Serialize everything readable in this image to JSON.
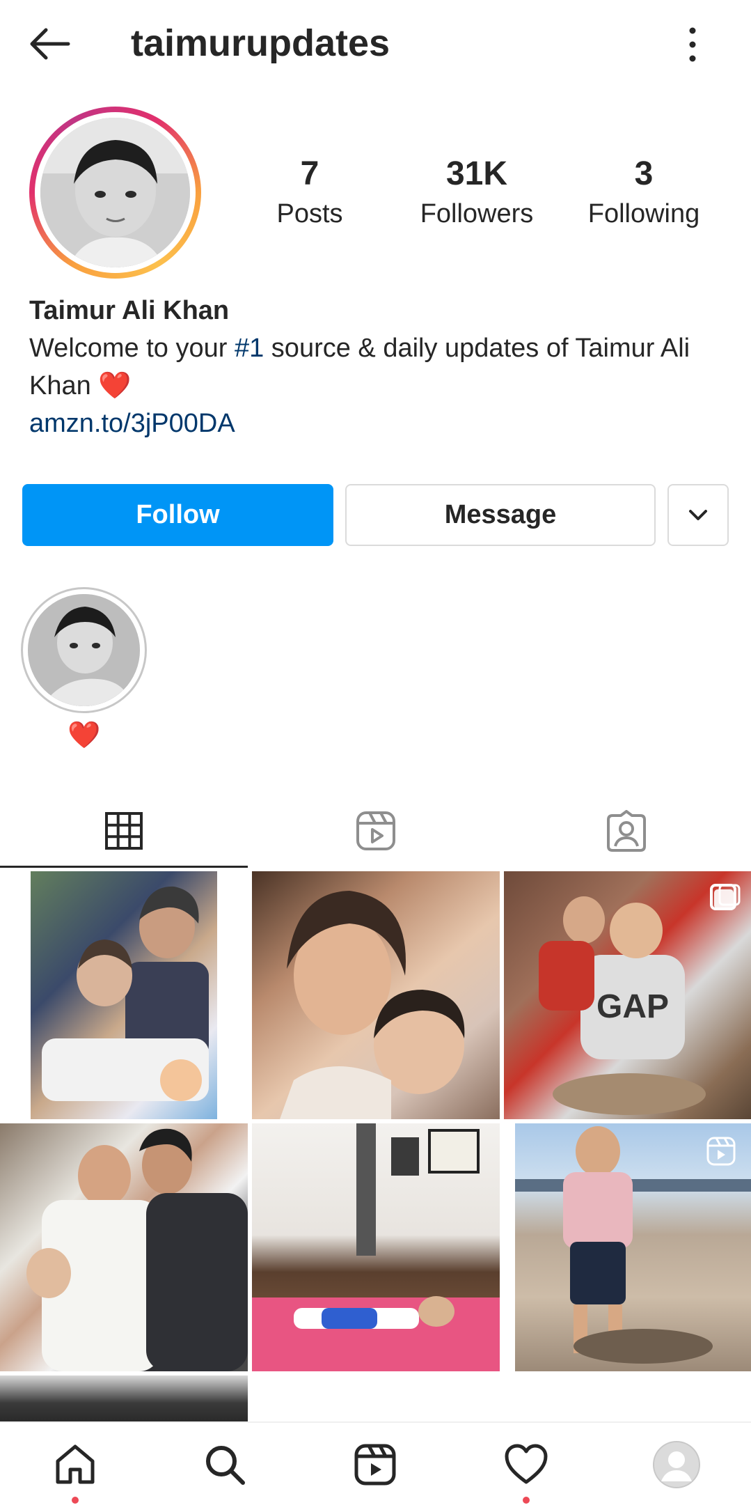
{
  "header": {
    "title": "taimurupdates",
    "back_icon": "arrow-left-icon",
    "more_icon": "more-vertical-icon"
  },
  "profile": {
    "stats": [
      {
        "value": "7",
        "label": "Posts"
      },
      {
        "value": "31K",
        "label": "Followers"
      },
      {
        "value": "3",
        "label": "Following"
      }
    ],
    "full_name": "Taimur Ali Khan",
    "bio_before": "Welcome to your ",
    "bio_tag": "#1",
    "bio_after": " source & daily updates of Taimur Ali Khan ",
    "bio_emoji": "❤️",
    "link": "amzn.to/3jP00DA"
  },
  "actions": {
    "follow": "Follow",
    "message": "Message",
    "dropdown_icon": "chevron-down-icon"
  },
  "highlights": [
    {
      "label": "❤️"
    }
  ],
  "tabs": [
    {
      "name": "grid",
      "icon": "grid-icon",
      "active": true
    },
    {
      "name": "reels",
      "icon": "reels-icon",
      "active": false
    },
    {
      "name": "tagged",
      "icon": "tagged-user-icon",
      "active": false
    }
  ],
  "nav": {
    "items": [
      "home-icon",
      "search-icon",
      "reels-icon",
      "heart-icon",
      "profile-icon"
    ]
  },
  "colors": {
    "primary": "#0095f6",
    "link": "#00376b",
    "text": "#262626",
    "notification_dot": "#ed4956"
  }
}
